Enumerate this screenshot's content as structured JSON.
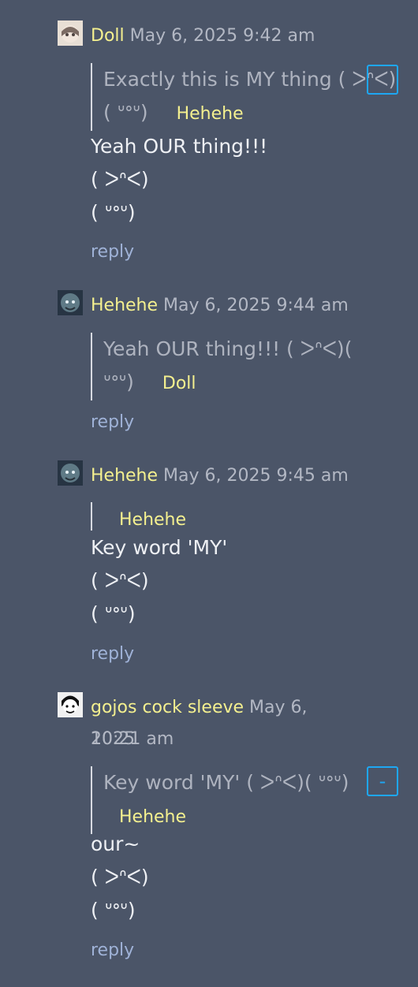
{
  "comments": [
    {
      "username": "Doll",
      "timestamp": "May 6, 2025 9:42 am",
      "quote_text": "Exactly this is MY thing ( ᐳᐢᐸ)",
      "quote_text_2": "( ᐡᐤᐡ)",
      "quote_author": "Hehehe",
      "body": [
        "Yeah OUR thing!!!",
        "( ᐳᐢᐸ)",
        "( ᐡᐤᐡ)"
      ],
      "reply": "reply"
    },
    {
      "username": "Hehehe",
      "timestamp": "May 6, 2025 9:44 am",
      "quote_text": "Yeah OUR thing!!! ( ᐳᐢᐸ)(",
      "quote_text_2": "ᐡᐤᐡ)",
      "quote_author": "Doll",
      "body": [],
      "reply": "reply"
    },
    {
      "username": "Hehehe",
      "timestamp": "May 6, 2025 9:45 am",
      "quote_author": "Hehehe",
      "body": [
        "Key word 'MY'",
        "( ᐳᐢᐸ)",
        "( ᐡᐤᐡ)"
      ],
      "reply": "reply"
    },
    {
      "username": "gojos cock sleeve",
      "timestamp": "May 6, 2025",
      "timestamp_2": "10:21 am",
      "quote_text": "Key word 'MY' ( ᐳᐢᐸ)( ᐡᐤᐡ)",
      "quote_author": "Hehehe",
      "body": [
        "our~",
        "( ᐳᐢᐸ)",
        "( ᐡᐤᐡ)"
      ],
      "reply": "reply"
    }
  ],
  "colors": {
    "background": "#4b5568",
    "username": "#f4f08f",
    "timestamp": "#b3b8c4",
    "reply": "#9fb2d7",
    "focus": "#1ea7f3"
  },
  "icons": {
    "avatar_1": "doll-avatar-icon",
    "avatar_2": "hehehe-avatar-icon",
    "avatar_3": "hehehe-avatar-icon",
    "avatar_4": "gojo-avatar-icon"
  }
}
